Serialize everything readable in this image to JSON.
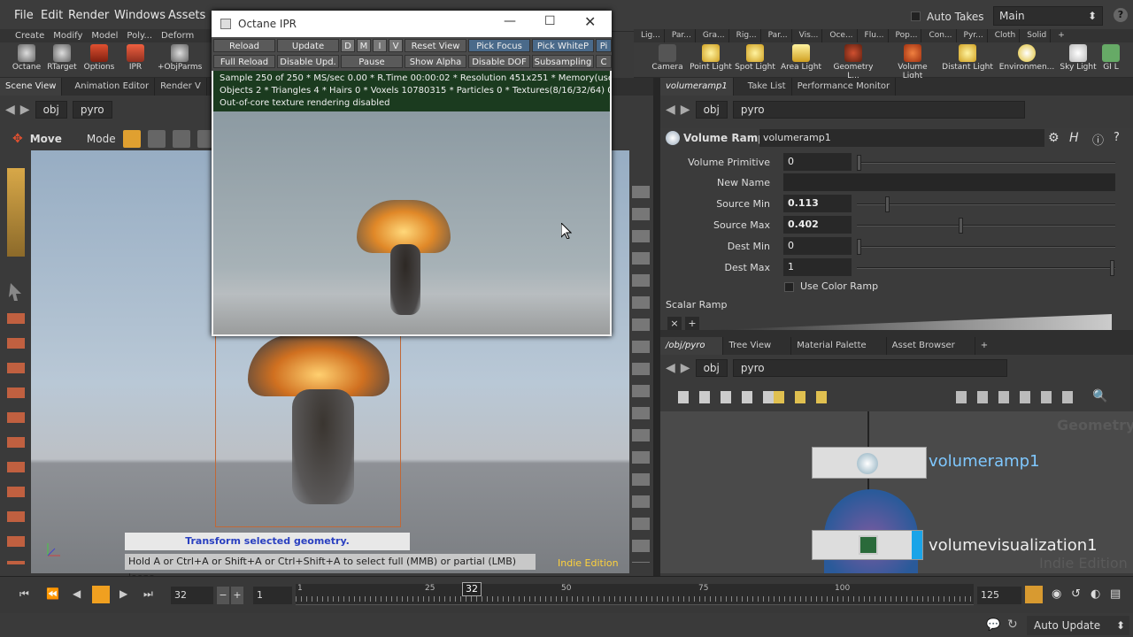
{
  "menubar": {
    "items": [
      "File",
      "Edit",
      "Render",
      "Windows",
      "Assets"
    ],
    "auto_takes": "Auto Takes",
    "desktop": "Main"
  },
  "shelf_left": {
    "tabs": [
      "Create",
      "Modify",
      "Model",
      "Poly...",
      "Deform"
    ],
    "tools": [
      "Octane",
      "RTarget",
      "Options",
      "IPR",
      "+ObjParms"
    ]
  },
  "shelf_right": {
    "tabs": [
      "Lig...",
      "Par...",
      "Gra...",
      "Rig...",
      "Par...",
      "Vis...",
      "Oce...",
      "Flu...",
      "Pop...",
      "Con...",
      "Pyr...",
      "Cloth",
      "Solid"
    ],
    "tools": [
      "Camera",
      "Point Light",
      "Spot Light",
      "Area Light",
      "Geometry L...",
      "Volume Light",
      "Distant Light",
      "Environmen...",
      "Sky Light",
      "GI L"
    ]
  },
  "viewer": {
    "tabs": [
      "Scene View",
      "Animation Editor",
      "Render V"
    ],
    "path_obj": "obj",
    "path_node": "pyro",
    "tool_label": "Move",
    "mode_label": "Mode",
    "tooltip": "Transform selected geometry.",
    "hint": "Hold A or Ctrl+A or Shift+A or Ctrl+Shift+A to select full (MMB) or partial (LMB) loops.",
    "edition": "Indie Edition"
  },
  "ipr": {
    "title": "Octane IPR",
    "row1": [
      "Reload",
      "Update",
      "D",
      "M",
      "I",
      "V",
      "Reset View",
      "Pick Focus",
      "Pick WhiteP",
      "Pi"
    ],
    "row2": [
      "Full Reload",
      "Disable Upd.",
      "Pause",
      "Show Alpha",
      "Disable DOF",
      "Subsampling",
      "C"
    ],
    "status1": "Sample 250 of 250 * MS/sec 0.00 * R.Time 00:00:02 * Resolution 451x251 * Memory(used/free)",
    "status2": "Objects 2 * Triangles 4 * Hairs 0 * Voxels 10780315 * Particles 0 * Textures(8/16/32/64) 0/0/0/0",
    "status3": "Out-of-core texture rendering disabled"
  },
  "params": {
    "tabs": [
      "volumeramp1",
      "Take List",
      "Performance Monitor"
    ],
    "path_obj": "obj",
    "path_node": "pyro",
    "node_type": "Volume Ramp",
    "node_name": "volumeramp1",
    "rows": [
      {
        "label": "Volume Primitive",
        "value": "0",
        "pos": 0
      },
      {
        "label": "New Name",
        "value": ""
      },
      {
        "label": "Source Min",
        "value": "0.113",
        "pos": 0.113
      },
      {
        "label": "Source Max",
        "value": "0.402",
        "pos": 0.402
      },
      {
        "label": "Dest Min",
        "value": "0",
        "pos": 0
      },
      {
        "label": "Dest Max",
        "value": "1",
        "pos": 1
      }
    ],
    "use_color_ramp": "Use Color Ramp",
    "scalar_ramp": "Scalar Ramp"
  },
  "network": {
    "tabs": [
      "/obj/pyro",
      "Tree View",
      "Material Palette",
      "Asset Browser"
    ],
    "path_obj": "obj",
    "path_node": "pyro",
    "watermark_context": "Geometry",
    "watermark_edition": "Indie Edition",
    "nodes": [
      "volumeramp1",
      "volumevisualization1"
    ]
  },
  "timeline": {
    "current_frame": "32",
    "start": "1",
    "end": "125",
    "ticks": [
      "1",
      "25",
      "50",
      "75",
      "100"
    ],
    "marker": "32",
    "progress": 0.26
  },
  "statusbar": {
    "auto_update": "Auto Update"
  },
  "colors": {
    "accent": "#f0a020",
    "node_name": "#7fc8ff",
    "ipr_status_bg": "#1b3b1f"
  }
}
